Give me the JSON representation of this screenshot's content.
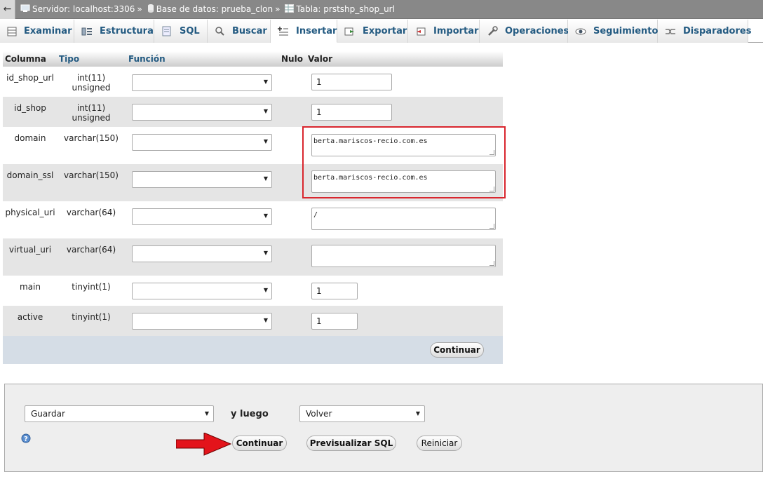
{
  "breadcrumb": {
    "server": "Servidor: localhost:3306",
    "sep": "»",
    "database": "Base de datos: prueba_clon",
    "table": "Tabla: prstshp_shop_url"
  },
  "tabs": [
    {
      "label": "Examinar",
      "icon": "browse-icon"
    },
    {
      "label": "Estructura",
      "icon": "structure-icon"
    },
    {
      "label": "SQL",
      "icon": "sql-icon"
    },
    {
      "label": "Buscar",
      "icon": "search-icon"
    },
    {
      "label": "Insertar",
      "icon": "insert-icon"
    },
    {
      "label": "Exportar",
      "icon": "export-icon"
    },
    {
      "label": "Importar",
      "icon": "import-icon"
    },
    {
      "label": "Operaciones",
      "icon": "wrench-icon"
    },
    {
      "label": "Seguimiento",
      "icon": "eye-icon"
    },
    {
      "label": "Disparadores",
      "icon": "triggers-icon"
    }
  ],
  "table_headers": {
    "columna": "Columna",
    "tipo": "Tipo",
    "funcion": "Función",
    "nulo": "Nulo",
    "valor": "Valor"
  },
  "rows": [
    {
      "name": "id_shop_url",
      "type": "int(11) unsigned",
      "value": "1"
    },
    {
      "name": "id_shop",
      "type": "int(11) unsigned",
      "value": "1"
    },
    {
      "name": "domain",
      "type": "varchar(150)",
      "value": "berta.mariscos-recio.com.es"
    },
    {
      "name": "domain_ssl",
      "type": "varchar(150)",
      "value": "berta.mariscos-recio.com.es"
    },
    {
      "name": "physical_uri",
      "type": "varchar(64)",
      "value": "/"
    },
    {
      "name": "virtual_uri",
      "type": "varchar(64)",
      "value": ""
    },
    {
      "name": "main",
      "type": "tinyint(1)",
      "value": "1"
    },
    {
      "name": "active",
      "type": "tinyint(1)",
      "value": "1"
    }
  ],
  "table_continue": "Continuar",
  "bottom": {
    "action_select": "Guardar",
    "then_label": "y luego",
    "after_select": "Volver",
    "continue": "Continuar",
    "preview_sql": "Previsualizar SQL",
    "reset": "Reiniciar"
  },
  "colors": {
    "highlight": "#d9262e",
    "arrow": "#e3141b",
    "link": "#235a81"
  }
}
